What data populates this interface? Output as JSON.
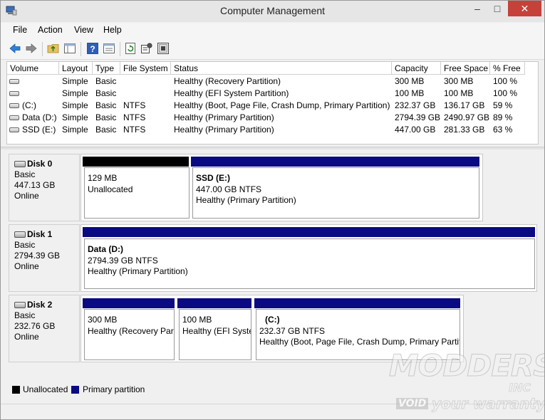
{
  "window": {
    "title": "Computer Management"
  },
  "window_buttons": {
    "minimize": "–",
    "maximize": "□",
    "close": "✕"
  },
  "menu": [
    "File",
    "Action",
    "View",
    "Help"
  ],
  "toolbar_icons": [
    "back-arrow-icon",
    "forward-arrow-icon",
    "folder-up-icon",
    "show-hide-tree-icon",
    "help-icon",
    "properties-icon",
    "refresh-icon",
    "settings-icon",
    "export-icon"
  ],
  "volume_list": {
    "columns": [
      "Volume",
      "Layout",
      "Type",
      "File System",
      "Status",
      "Capacity",
      "Free Space",
      "% Free"
    ],
    "rows": [
      {
        "volume": "",
        "layout": "Simple",
        "type": "Basic",
        "fs": "",
        "status": "Healthy (Recovery Partition)",
        "capacity": "300 MB",
        "free": "300 MB",
        "pct": "100 %"
      },
      {
        "volume": "",
        "layout": "Simple",
        "type": "Basic",
        "fs": "",
        "status": "Healthy (EFI System Partition)",
        "capacity": "100 MB",
        "free": "100 MB",
        "pct": "100 %"
      },
      {
        "volume": "(C:)",
        "layout": "Simple",
        "type": "Basic",
        "fs": "NTFS",
        "status": "Healthy (Boot, Page File, Crash Dump, Primary Partition)",
        "capacity": "232.37 GB",
        "free": "136.17 GB",
        "pct": "59 %"
      },
      {
        "volume": "Data (D:)",
        "layout": "Simple",
        "type": "Basic",
        "fs": "NTFS",
        "status": "Healthy (Primary Partition)",
        "capacity": "2794.39 GB",
        "free": "2490.97 GB",
        "pct": "89 %"
      },
      {
        "volume": "SSD (E:)",
        "layout": "Simple",
        "type": "Basic",
        "fs": "NTFS",
        "status": "Healthy (Primary Partition)",
        "capacity": "447.00 GB",
        "free": "281.33 GB",
        "pct": "63 %"
      }
    ]
  },
  "disks": [
    {
      "name": "Disk 0",
      "type": "Basic",
      "size": "447.13 GB",
      "state": "Online",
      "partitions": [
        {
          "title": "",
          "line1": "129 MB",
          "line2": "Unallocated",
          "kind": "unallocated"
        },
        {
          "title": "SSD  (E:)",
          "line1": "447.00 GB NTFS",
          "line2": "Healthy (Primary Partition)",
          "kind": "primary"
        }
      ]
    },
    {
      "name": "Disk 1",
      "type": "Basic",
      "size": "2794.39 GB",
      "state": "Online",
      "partitions": [
        {
          "title": "Data  (D:)",
          "line1": "2794.39 GB NTFS",
          "line2": "Healthy (Primary Partition)",
          "kind": "primary"
        }
      ]
    },
    {
      "name": "Disk 2",
      "type": "Basic",
      "size": "232.76 GB",
      "state": "Online",
      "partitions": [
        {
          "title": "",
          "line1": "300 MB",
          "line2": "Healthy (Recovery Par",
          "kind": "primary"
        },
        {
          "title": "",
          "line1": "100 MB",
          "line2": "Healthy (EFI Syste",
          "kind": "primary"
        },
        {
          "title": "(C:)",
          "line1": "232.37 GB NTFS",
          "line2": "Healthy (Boot, Page File, Crash Dump, Primary Partit",
          "kind": "primary"
        }
      ]
    }
  ],
  "legend": [
    {
      "label": "Unallocated",
      "color": "#000000"
    },
    {
      "label": "Primary partition",
      "color": "#0a0a82"
    }
  ],
  "watermark": {
    "main": "MODDERS",
    "inc": "INC",
    "void": "VOID",
    "tagline": "your warranty"
  }
}
